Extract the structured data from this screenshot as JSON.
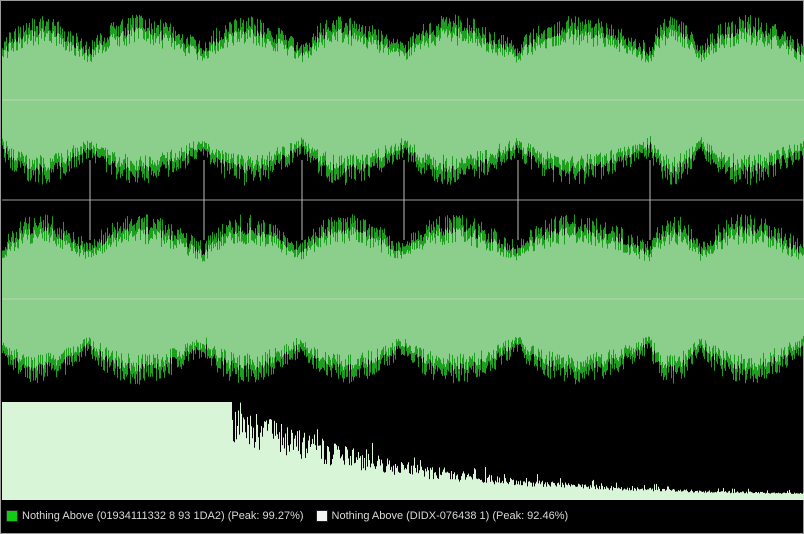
{
  "legend": {
    "items": [
      {
        "swatch_color": "#11cc11",
        "label": "Nothing Above (01934111332 8 93 1DA2) (Peak: 99.27%)"
      },
      {
        "swatch_color": "#f4f4f4",
        "label": "Nothing Above (DIDX-076438 1) (Peak: 92.46%)"
      }
    ]
  },
  "colors": {
    "background": "#000000",
    "wave_dark": "#1f9f1f",
    "wave_light": "#8ccf8c",
    "spectrum": "#d8f5d8",
    "markers": "#bdbdbd",
    "center_line": "#b9d9b9"
  }
}
